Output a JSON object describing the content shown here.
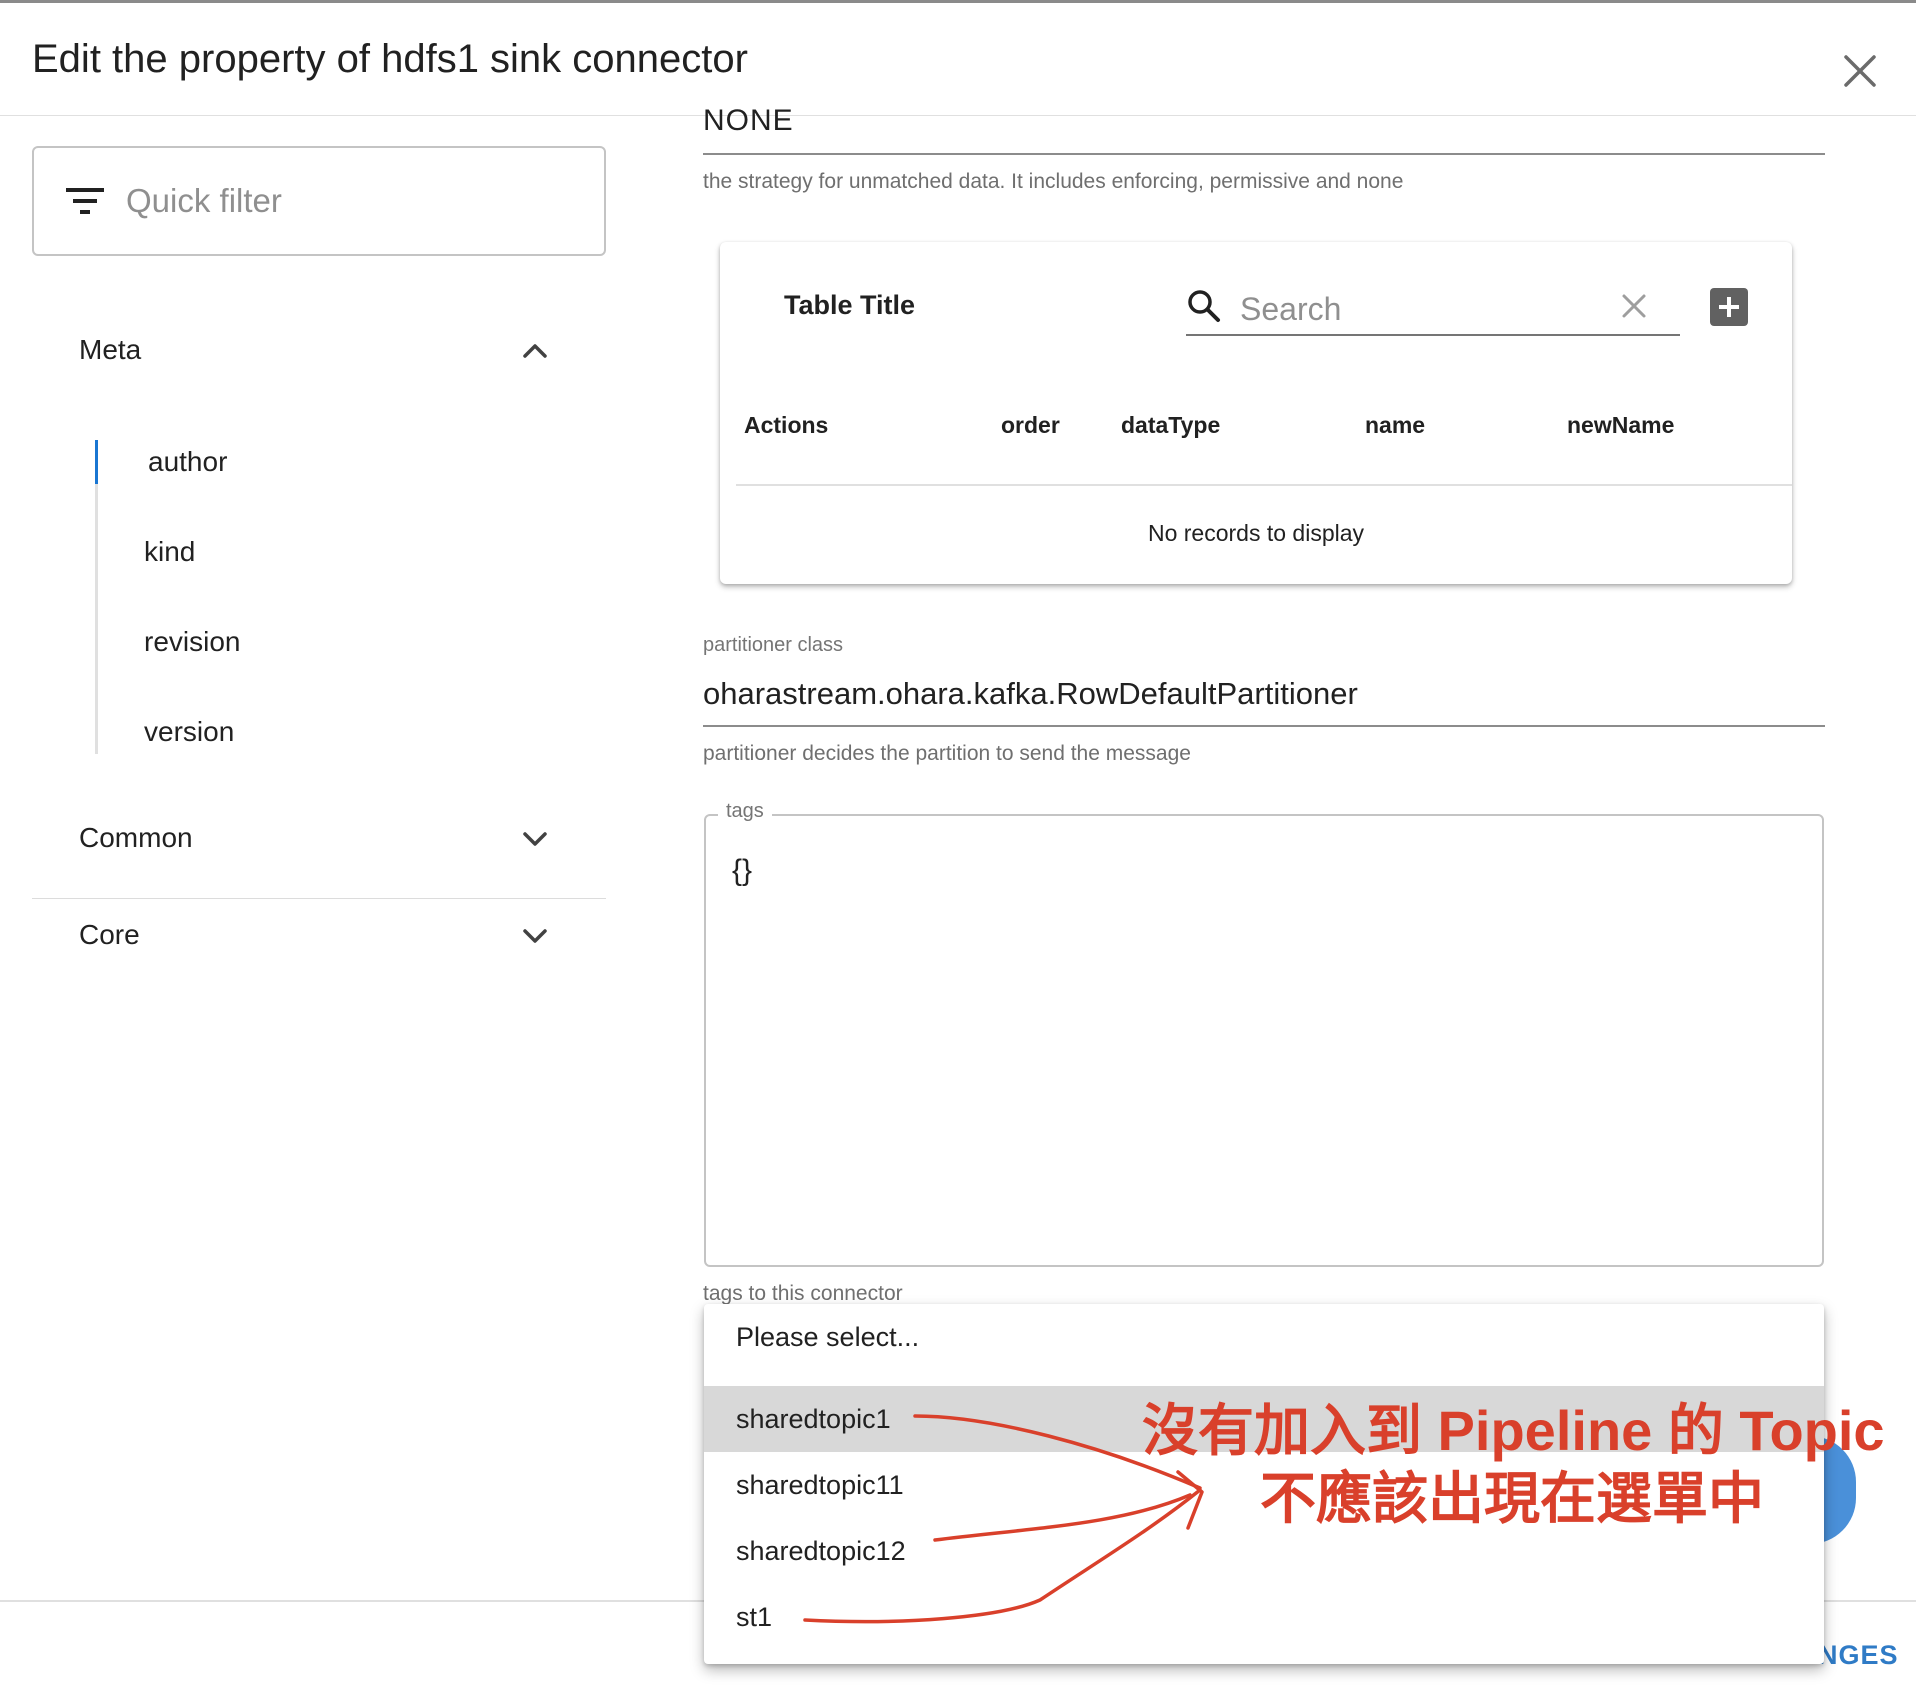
{
  "dialog": {
    "title": "Edit the property of hdfs1 sink connector"
  },
  "sidebar": {
    "filter_placeholder": "Quick filter",
    "sections": [
      {
        "label": "Meta",
        "expanded": true,
        "items": [
          "author",
          "kind",
          "revision",
          "version"
        ],
        "active_item": "author"
      },
      {
        "label": "Common",
        "expanded": false
      },
      {
        "label": "Core",
        "expanded": false
      }
    ]
  },
  "form": {
    "check_rule": {
      "value": "NONE",
      "helper": "the strategy for unmatched data. It includes enforcing, permissive and none"
    },
    "table": {
      "title": "Table Title",
      "search_placeholder": "Search",
      "columns": [
        "Actions",
        "order",
        "dataType",
        "name",
        "newName"
      ],
      "empty_text": "No records to display"
    },
    "partitioner": {
      "label": "partitioner class",
      "value": "oharastream.ohara.kafka.RowDefaultPartitioner",
      "helper": "partitioner decides the partition to send the message"
    },
    "tags": {
      "label": "tags",
      "value": "{}",
      "helper": "tags to this connector"
    }
  },
  "dropdown": {
    "options": [
      "Please select...",
      "sharedtopic1",
      "sharedtopic11",
      "sharedtopic12",
      "st1"
    ],
    "highlighted": "sharedtopic1"
  },
  "footer": {
    "save_label_visible": "NGES"
  },
  "annotation": {
    "line1": "沒有加入到 Pipeline 的 Topic",
    "line2": "不應該出現在選單中",
    "color": "#d9402b"
  },
  "colors": {
    "accent": "#1976d2",
    "fab": "#4a90d9",
    "footer_button": "#2f7bc6"
  }
}
